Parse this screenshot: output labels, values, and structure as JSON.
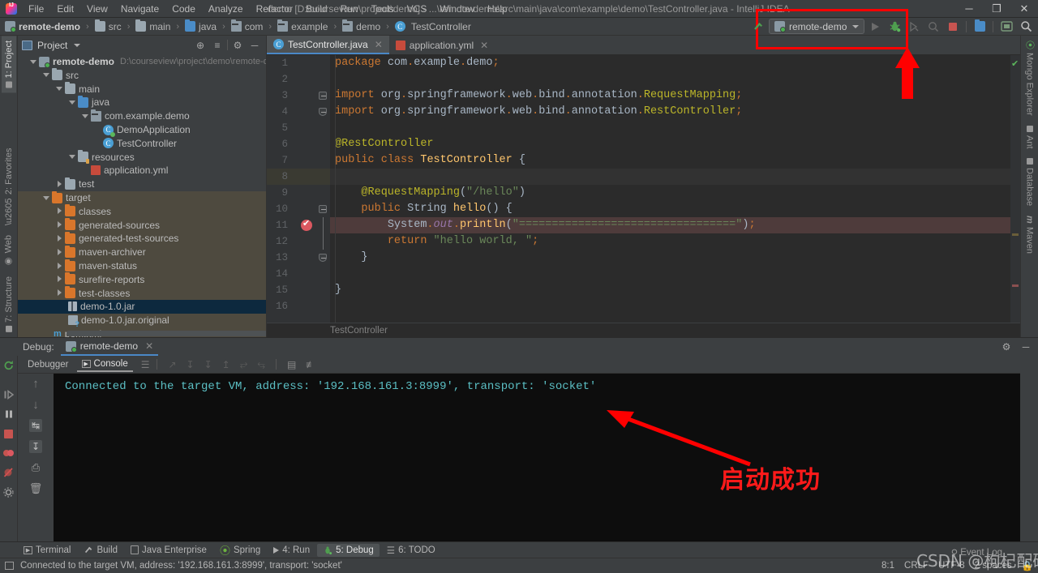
{
  "window": {
    "title": "demo [D:\\courseview\\project\\demo] - ...\\remote-demo\\src\\main\\java\\com\\example\\demo\\TestController.java - IntelliJ IDEA",
    "minimize": "─",
    "maximize": "❐",
    "close": "✕"
  },
  "menubar": {
    "items": [
      {
        "label": "File"
      },
      {
        "label": "Edit"
      },
      {
        "label": "View"
      },
      {
        "label": "Navigate"
      },
      {
        "label": "Code"
      },
      {
        "label": "Analyze"
      },
      {
        "label": "Refactor"
      },
      {
        "label": "Build"
      },
      {
        "label": "Run"
      },
      {
        "label": "Tools"
      },
      {
        "label": "VCS"
      },
      {
        "label": "Window"
      },
      {
        "label": "Help"
      }
    ]
  },
  "breadcrumb": {
    "items": [
      {
        "label": "remote-demo",
        "icon": "module-icon"
      },
      {
        "label": "src",
        "icon": "folder-icon"
      },
      {
        "label": "main",
        "icon": "folder-icon"
      },
      {
        "label": "java",
        "icon": "source-folder-icon"
      },
      {
        "label": "com",
        "icon": "package-icon"
      },
      {
        "label": "example",
        "icon": "package-icon"
      },
      {
        "label": "demo",
        "icon": "package-icon"
      },
      {
        "label": "TestController",
        "icon": "class-icon"
      }
    ],
    "separator": "›"
  },
  "run_toolbar": {
    "build_label": "Build",
    "config_name": "remote-demo",
    "run_label": "Run",
    "debug_label": "Debug",
    "run_with_coverage_label": "Run with Coverage",
    "profile_label": "Profile",
    "stop_label": "Stop",
    "select_opened_file_label": "Select Opened File",
    "preview_label": "Preview",
    "search_label": "Search Everywhere",
    "search_icon": "magnifier-icon"
  },
  "project_panel": {
    "title": "Project",
    "dropdown_icon": "chevron-down-icon",
    "actions": [
      {
        "name": "locate-icon",
        "glyph": "⊕"
      },
      {
        "name": "collapse-all-icon",
        "glyph": "≡"
      },
      {
        "name": "gear-icon",
        "glyph": "⚙"
      },
      {
        "name": "hide-icon",
        "glyph": "─"
      }
    ],
    "tree": [
      {
        "label": "remote-demo",
        "path": "D:\\courseview\\project\\demo\\remote-d",
        "indent": 0,
        "arrow": "down",
        "icon": "module-icon",
        "bold": true
      },
      {
        "label": "src",
        "indent": 1,
        "arrow": "down",
        "icon": "folder-icon"
      },
      {
        "label": "main",
        "indent": 2,
        "arrow": "down",
        "icon": "folder-icon"
      },
      {
        "label": "java",
        "indent": 3,
        "arrow": "down",
        "icon": "source-folder-icon"
      },
      {
        "label": "com.example.demo",
        "indent": 4,
        "arrow": "down",
        "icon": "package-icon"
      },
      {
        "label": "DemoApplication",
        "indent": 5,
        "arrow": "none",
        "icon": "class-run-icon"
      },
      {
        "label": "TestController",
        "indent": 5,
        "arrow": "none",
        "icon": "class-icon"
      },
      {
        "label": "resources",
        "indent": 3,
        "arrow": "down",
        "icon": "resource-folder-icon"
      },
      {
        "label": "application.yml",
        "indent": 4,
        "arrow": "none",
        "icon": "yml-icon"
      },
      {
        "label": "test",
        "indent": 2,
        "arrow": "right",
        "icon": "folder-icon"
      },
      {
        "label": "target",
        "indent": 1,
        "arrow": "down",
        "icon": "excluded-folder-icon",
        "highlight": true
      },
      {
        "label": "classes",
        "indent": 2,
        "arrow": "right",
        "icon": "excluded-folder-icon",
        "highlight": true
      },
      {
        "label": "generated-sources",
        "indent": 2,
        "arrow": "right",
        "icon": "excluded-folder-icon",
        "highlight": true
      },
      {
        "label": "generated-test-sources",
        "indent": 2,
        "arrow": "right",
        "icon": "excluded-folder-icon",
        "highlight": true
      },
      {
        "label": "maven-archiver",
        "indent": 2,
        "arrow": "right",
        "icon": "excluded-folder-icon",
        "highlight": true
      },
      {
        "label": "maven-status",
        "indent": 2,
        "arrow": "right",
        "icon": "excluded-folder-icon",
        "highlight": true
      },
      {
        "label": "surefire-reports",
        "indent": 2,
        "arrow": "right",
        "icon": "excluded-folder-icon",
        "highlight": true
      },
      {
        "label": "test-classes",
        "indent": 2,
        "arrow": "right",
        "icon": "excluded-folder-icon",
        "highlight": true
      },
      {
        "label": "demo-1.0.jar",
        "indent": 3,
        "arrow": "none",
        "icon": "jar-icon",
        "selected": true
      },
      {
        "label": "demo-1.0.jar.original",
        "indent": 3,
        "arrow": "none",
        "icon": "unknown-file-icon",
        "highlight": true
      },
      {
        "label": "pom.xml",
        "indent": 1,
        "arrow": "none",
        "icon": "maven-icon",
        "highlight": true
      }
    ]
  },
  "editor": {
    "tabs": [
      {
        "label": "TestController.java",
        "icon": "java-class-icon",
        "active": true,
        "close": "✕"
      },
      {
        "label": "application.yml",
        "icon": "yml-icon",
        "active": false,
        "close": "✕"
      }
    ],
    "breadcrumb_bottom": "TestController",
    "lines": [
      {
        "n": 1,
        "html": "<span class='kw'>package</span> <span class='pkgn'>com</span><span class='sem'>.</span><span class='pkgn'>example</span><span class='sem'>.</span><span class='pkgn'>demo</span><span class='sem'>;</span>",
        "text": "package com.example.demo;"
      },
      {
        "n": 2,
        "html": "",
        "text": ""
      },
      {
        "n": 3,
        "html": "<span class='kw'>import</span> <span class='pkgn'>org</span><span class='sem'>.</span><span class='pkgn'>springframework</span><span class='sem'>.</span><span class='pkgn'>web</span><span class='sem'>.</span><span class='pkgn'>bind</span><span class='sem'>.</span><span class='pkgn'>annotation</span><span class='sem'>.</span><span class='an'>RequestMapping</span><span class='sem'>;</span>",
        "text": "import org.springframework.web.bind.annotation.RequestMapping;",
        "fold": "import"
      },
      {
        "n": 4,
        "html": "<span class='kw'>import</span> <span class='pkgn'>org</span><span class='sem'>.</span><span class='pkgn'>springframework</span><span class='sem'>.</span><span class='pkgn'>web</span><span class='sem'>.</span><span class='pkgn'>bind</span><span class='sem'>.</span><span class='pkgn'>annotation</span><span class='sem'>.</span><span class='an'>RestController</span><span class='sem'>;</span>",
        "text": "import org.springframework.web.bind.annotation.RestController;",
        "fold": "import2"
      },
      {
        "n": 5,
        "html": "",
        "text": ""
      },
      {
        "n": 6,
        "html": "<span class='an'>@RestController</span>",
        "text": "@RestController"
      },
      {
        "n": 7,
        "html": "<span class='kw'>public</span> <span class='kw'>class</span> <span class='fn'>TestController</span> <span class='ty'>{</span>",
        "text": "public class TestController {"
      },
      {
        "n": 8,
        "html": "",
        "text": "",
        "current": true
      },
      {
        "n": 9,
        "html": "    <span class='an'>@RequestMapping</span><span class='ty'>(</span><span class='str'>\"/hello\"</span><span class='ty'>)</span>",
        "text": "    @RequestMapping(\"/hello\")"
      },
      {
        "n": 10,
        "html": "    <span class='kw'>public</span> <span class='ty'>String</span> <span class='fn'>hello</span><span class='ty'>() {</span>",
        "text": "    public String hello() {",
        "fold": "method"
      },
      {
        "n": 11,
        "html": "        <span class='ty'>System</span><span class='sem'>.</span><span class='stat'>out</span><span class='sem'>.</span><span class='fn'>println</span><span class='ty'>(</span><span class='str'>\"=================================\"</span><span class='ty'>)</span><span class='sem'>;</span>",
        "text": "        System.out.println(\"=================================\");",
        "breakpoint": true,
        "highlight": true
      },
      {
        "n": 12,
        "html": "        <span class='kw'>return</span> <span class='str'>\"hello world, \"</span><span class='sem'>;</span>",
        "text": "        return \"hello world, \";"
      },
      {
        "n": 13,
        "html": "    <span class='ty'>}</span>",
        "text": "    }",
        "fold": "end"
      },
      {
        "n": 14,
        "html": "",
        "text": ""
      },
      {
        "n": 15,
        "html": "<span class='ty'>}</span>",
        "text": "}"
      },
      {
        "n": 16,
        "html": "",
        "text": ""
      }
    ]
  },
  "debug": {
    "label": "Debug:",
    "session": "remote-demo",
    "close": "✕",
    "settings_icon": "gear-icon",
    "hide_icon": "hide-icon",
    "tabs": [
      {
        "label": "Debugger",
        "selected": false,
        "icon": "debugger-icon"
      },
      {
        "label": "Console",
        "selected": true,
        "icon": "console-icon"
      }
    ],
    "console_text": "Connected to the target VM, address: '192.168.161.3:8999', transport: 'socket'",
    "left_tools": [
      {
        "name": "rerun-icon",
        "glyph": "↻"
      },
      {
        "name": "resume-program-icon",
        "glyph": "▷"
      },
      {
        "name": "pause-program-icon",
        "glyph": "‖"
      },
      {
        "name": "stop-icon",
        "glyph": "■"
      },
      {
        "name": "view-breakpoints-icon",
        "glyph": "●"
      },
      {
        "name": "mute-breakpoints-icon",
        "glyph": "⊘"
      },
      {
        "name": "settings-icon",
        "glyph": "⚙"
      }
    ],
    "console_tools": [
      {
        "name": "scroll-up-icon",
        "glyph": "↑"
      },
      {
        "name": "scroll-down-icon",
        "glyph": "↓"
      },
      {
        "name": "soft-wrap-icon",
        "glyph": "↵"
      },
      {
        "name": "scroll-to-end-icon",
        "glyph": "↧"
      },
      {
        "name": "print-icon",
        "glyph": "⎙"
      },
      {
        "name": "clear-all-icon",
        "glyph": "🗑"
      }
    ],
    "step_tools": [
      {
        "name": "show-execution-point-icon",
        "glyph": "⤴"
      },
      {
        "name": "step-over-icon",
        "glyph": "↓"
      },
      {
        "name": "step-into-icon",
        "glyph": "↓"
      },
      {
        "name": "step-out-icon",
        "glyph": "↑"
      },
      {
        "name": "drop-frame-icon",
        "glyph": "↱"
      },
      {
        "name": "run-to-cursor-icon",
        "glyph": "↳"
      },
      {
        "name": "evaluate-expression-icon",
        "glyph": "▤"
      },
      {
        "name": "layout-settings-icon",
        "glyph": "☲"
      }
    ]
  },
  "left_strip": {
    "items": [
      {
        "label": "1: Project",
        "icon": "project-icon",
        "selected": true
      },
      {
        "label": "2: Favorites",
        "icon": "star-icon"
      },
      {
        "label": "Web",
        "icon": "web-icon"
      },
      {
        "label": "7: Structure",
        "icon": "structure-icon"
      }
    ]
  },
  "right_strip": {
    "items": [
      {
        "label": "Mongo Explorer",
        "icon": "leaf-icon"
      },
      {
        "label": "Ant",
        "icon": "ant-icon"
      },
      {
        "label": "Database",
        "icon": "database-icon"
      },
      {
        "label": "Maven",
        "icon": "maven-icon"
      }
    ]
  },
  "toolwindow_bar": {
    "items": [
      {
        "label": "Terminal",
        "icon": "terminal-icon",
        "selected": false
      },
      {
        "label": "Build",
        "icon": "hammer-icon",
        "selected": false
      },
      {
        "label": "Java Enterprise",
        "icon": "java-ee-icon",
        "selected": false
      },
      {
        "label": "Spring",
        "icon": "spring-leaf-icon",
        "selected": false
      },
      {
        "label": "4: Run",
        "icon": "run-icon",
        "selected": false
      },
      {
        "label": "5: Debug",
        "icon": "bug-icon",
        "selected": true
      },
      {
        "label": "6: TODO",
        "icon": "todo-icon",
        "selected": false
      }
    ]
  },
  "statusbar": {
    "message": "Connected to the target VM, address: '192.168.161.3:8999', transport: 'socket'",
    "message_icon": "console-icon",
    "caret_position": "8:1",
    "line_separator": "CRLF",
    "encoding": "UTF-8",
    "indent": "2 spaces",
    "event_log": "Event Log",
    "event_log_icon": "magnifier-icon",
    "lock_icon": "lock-icon"
  },
  "annotations": {
    "text_success": "启动成功",
    "box_color": "#ff0000",
    "arrow_color": "#ff0000"
  },
  "watermark": {
    "text": "CSDN @枸杞配码"
  }
}
